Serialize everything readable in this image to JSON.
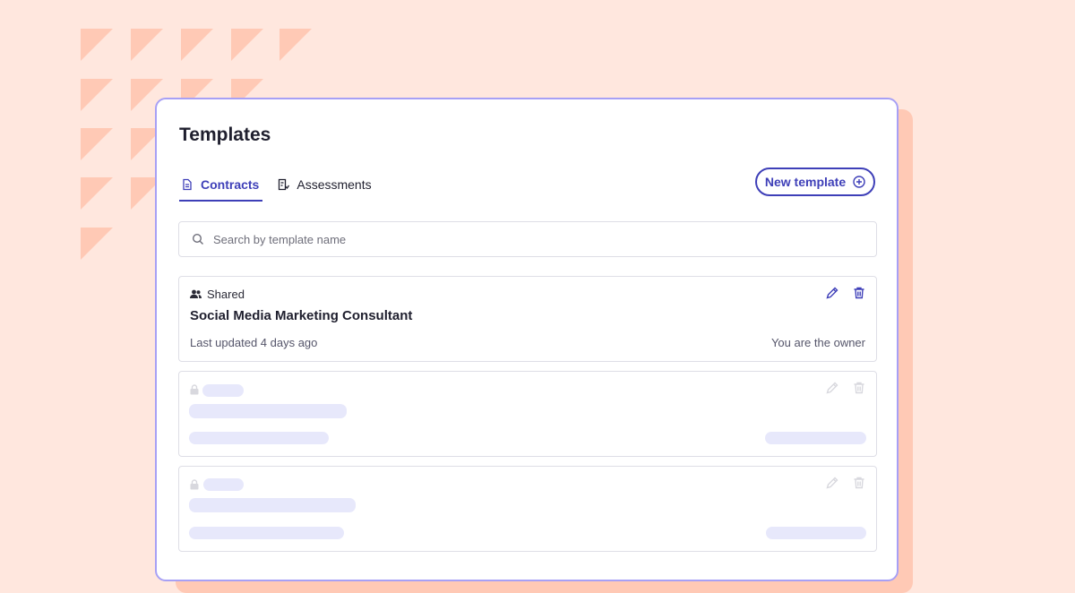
{
  "colors": {
    "accent": "#3E3FB8",
    "background": "#FFE7DE",
    "decor": "#FFC9B5",
    "skeleton": "#E7E8FB"
  },
  "panel": {
    "title": "Templates",
    "tabs": [
      {
        "label": "Contracts",
        "icon": "document-icon",
        "active": true
      },
      {
        "label": "Assessments",
        "icon": "checklist-icon",
        "active": false
      }
    ],
    "new_template_label": "New template",
    "search": {
      "placeholder": "Search by template name",
      "value": ""
    },
    "templates": [
      {
        "visibility": "Shared",
        "name": "Social Media Marketing Consultant",
        "last_updated": "Last updated 4 days ago",
        "owner": "You are the owner"
      }
    ],
    "loading_placeholders": 2
  }
}
